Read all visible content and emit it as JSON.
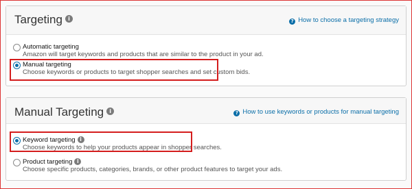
{
  "targeting_panel": {
    "title": "Targeting",
    "help_link": "How to choose a targeting strategy",
    "options": [
      {
        "label": "Automatic targeting",
        "description": "Amazon will target keywords and products that are similar to the product in your ad.",
        "selected": false
      },
      {
        "label": "Manual targeting",
        "description": "Choose keywords or products to target shopper searches and set custom bids.",
        "selected": true
      }
    ]
  },
  "manual_panel": {
    "title": "Manual Targeting",
    "help_link": "How to use keywords or products for manual targeting",
    "options": [
      {
        "label": "Keyword targeting",
        "description": "Choose keywords to help your products appear in shopper searches.",
        "selected": true
      },
      {
        "label": "Product targeting",
        "description": "Choose specific products, categories, brands, or other product features to target your ads.",
        "selected": false
      }
    ]
  },
  "icons": {
    "info": "i",
    "help": "?"
  },
  "colors": {
    "accent": "#0a6ea8",
    "highlight": "#d41c1c"
  }
}
